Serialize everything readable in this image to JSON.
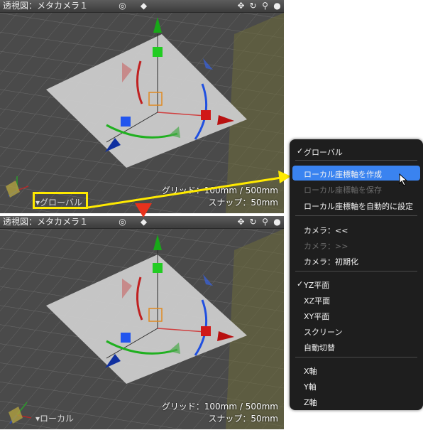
{
  "top_view": {
    "title": "透視図：メタカメラ１",
    "grid_label": "グリッド：100mm / 500mm",
    "snap_label": "スナップ：50mm",
    "coord_label": "▾グローバル"
  },
  "bottom_view": {
    "title": "透視図：メタカメラ１",
    "grid_label": "グリッド：100mm / 500mm",
    "snap_label": "スナップ：50mm",
    "coord_label": "▾ローカル"
  },
  "toolbar_icons": [
    "target-icon",
    "cube-icon",
    "move-icon",
    "rotate-icon",
    "zoom-icon",
    "sphere-icon"
  ],
  "menu": {
    "global": "グローバル",
    "create_local": "ローカル座標軸を作成",
    "save_local": "ローカル座標軸を保存",
    "auto_local": "ローカル座標軸を自動的に設定",
    "camera_back": "カメラ：<<",
    "camera_forward": "カメラ：>>",
    "camera_reset": "カメラ：初期化",
    "yz": "YZ平面",
    "xz": "XZ平面",
    "xy": "XY平面",
    "screen": "スクリーン",
    "auto_switch": "自動切替",
    "x_axis": "X軸",
    "y_axis": "Y軸",
    "z_axis": "Z軸"
  },
  "colors": {
    "highlight": "#ffea00",
    "menu_selected": "#3a83f0",
    "transition_arrow": "#e8321c"
  }
}
